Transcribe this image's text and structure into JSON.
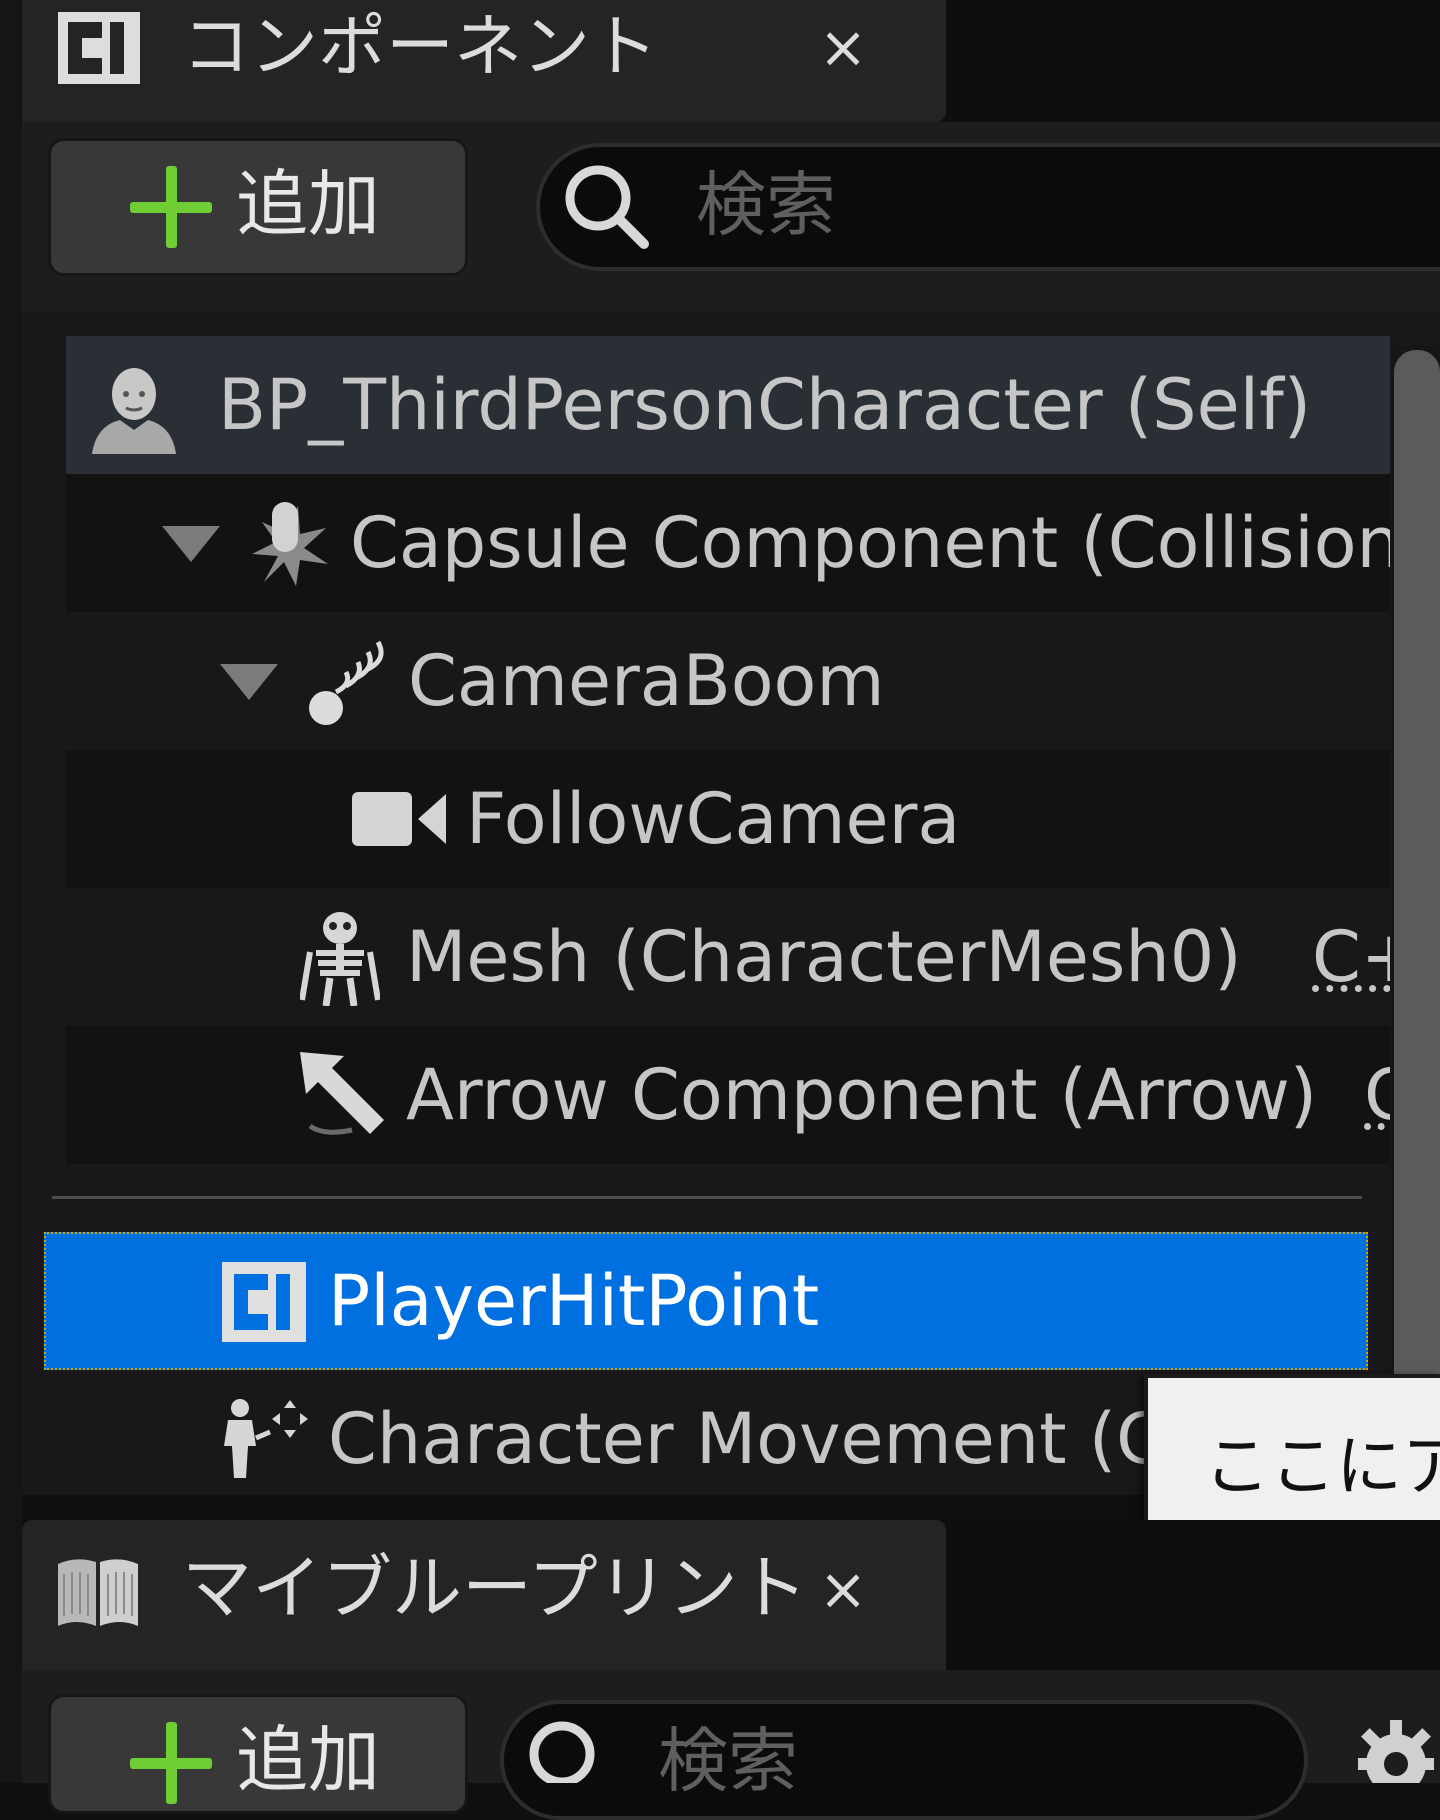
{
  "components_panel": {
    "tab": {
      "title": "コンポーネント",
      "close_label": "×",
      "icon": "component-icon"
    },
    "toolbar": {
      "add_label": "追加",
      "search_placeholder": "検索"
    },
    "tree": {
      "self_row": {
        "label": "BP_ThirdPersonCharacter (Self)",
        "icon": "character-self-icon"
      },
      "items": [
        {
          "label": "Capsule Component (Collision",
          "icon": "capsule-icon",
          "expanded": true
        },
        {
          "label": "CameraBoom",
          "icon": "spring-arm-icon",
          "expanded": true
        },
        {
          "label": "FollowCamera",
          "icon": "camera-icon"
        },
        {
          "label": "Mesh (CharacterMesh0)",
          "suffix": "C+",
          "icon": "skeletal-mesh-icon"
        },
        {
          "label": "Arrow Component (Arrow)",
          "suffix": "C",
          "icon": "arrow-icon"
        }
      ],
      "selected": {
        "label": "PlayerHitPoint",
        "icon": "component-icon"
      },
      "movement": {
        "label": "Character Movement (C",
        "icon": "character-movement-icon"
      }
    },
    "tooltip": {
      "text": "ここにア"
    }
  },
  "blueprint_panel": {
    "tab": {
      "title": "マイブループリント",
      "close_label": "×",
      "icon": "blueprint-book-icon"
    },
    "toolbar": {
      "add_label": "追加",
      "search_placeholder": "検索",
      "settings_icon": "gear-icon"
    }
  },
  "colors": {
    "selection": "#0070e0",
    "add_plus": "#6fce34",
    "panel_bg": "#181818",
    "tab_bg": "#242424"
  }
}
